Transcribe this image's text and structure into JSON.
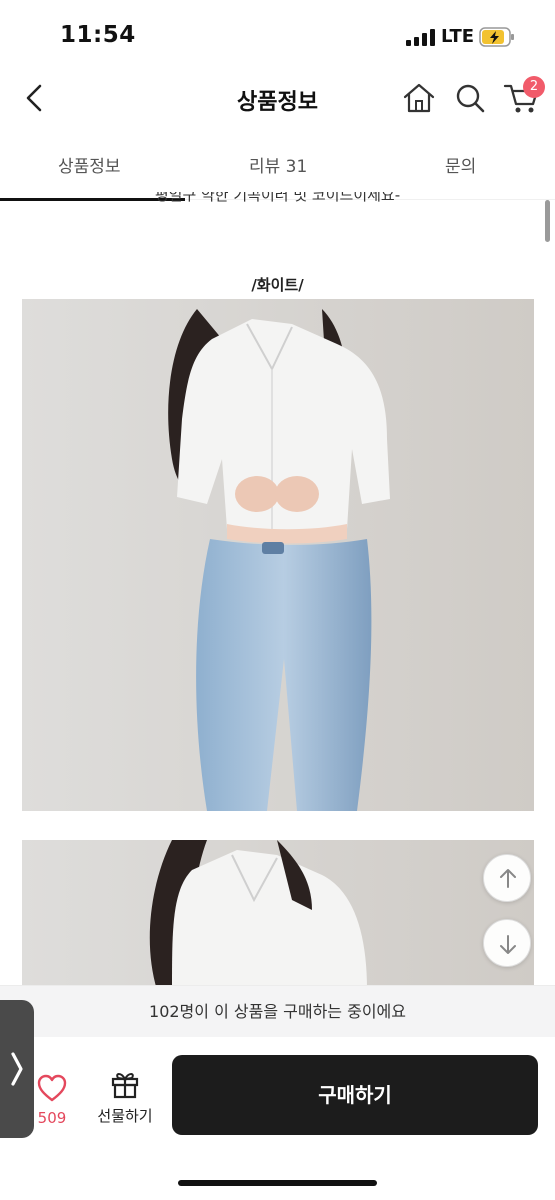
{
  "status_bar": {
    "time": "11:54",
    "network": "LTE"
  },
  "header": {
    "title": "상품정보",
    "cart_count": "2"
  },
  "tabs": [
    {
      "label": "상품정보",
      "active": true
    },
    {
      "label": "리뷰 31",
      "active": false
    },
    {
      "label": "문의",
      "active": false
    }
  ],
  "content": {
    "cut_text": "평일구 약한 기곡이러 멋 코이드이세요-",
    "caption": "/화이트/"
  },
  "bottom": {
    "buying_text": "102명이 이 상품을 구매하는 중이에요",
    "like_count": "509",
    "gift_label": "선물하기",
    "buy_label": "구매하기"
  },
  "colors": {
    "accent": "#f15b6a",
    "like": "#e4485d",
    "buy_button": "#1c1c1c"
  }
}
